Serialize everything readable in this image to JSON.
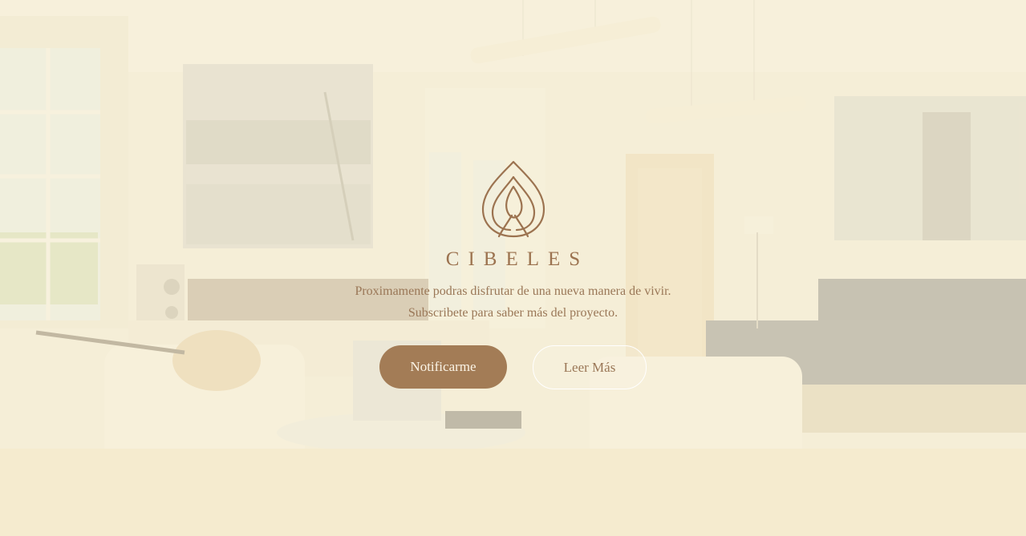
{
  "brand": {
    "name": "CIBELES",
    "logo_icon": "lotus-leaf-icon",
    "color": "#9c7350"
  },
  "hero": {
    "tagline_line1": "Proximamente podras disfrutar de una nueva manera de vivir.",
    "tagline_line2": "Subscribete para saber más del proyecto."
  },
  "actions": {
    "primary_label": "Notificarme",
    "secondary_label": "Leer Más",
    "primary_color": "#a37c56"
  }
}
